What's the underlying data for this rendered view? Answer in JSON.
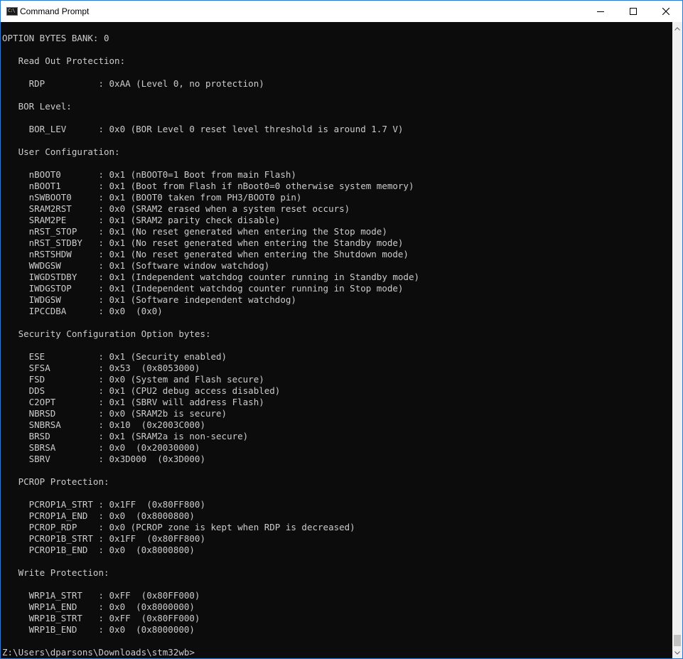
{
  "window": {
    "title": "Command Prompt",
    "icon_name": "cmd-app-icon",
    "icon_glyph": "C:\\",
    "border_color": "#2b79d0",
    "background": "#0c0c0c",
    "foreground": "#cccccc"
  },
  "caption_buttons": {
    "minimize": "minimize-icon",
    "maximize": "maximize-icon",
    "close": "close-icon"
  },
  "console": {
    "lines": [
      "OPTION BYTES BANK: 0",
      "",
      "   Read Out Protection:",
      "",
      "     RDP          : 0xAA (Level 0, no protection)",
      "",
      "   BOR Level:",
      "",
      "     BOR_LEV      : 0x0 (BOR Level 0 reset level threshold is around 1.7 V)",
      "",
      "   User Configuration:",
      "",
      "     nBOOT0       : 0x1 (nBOOT0=1 Boot from main Flash)",
      "     nBOOT1       : 0x1 (Boot from Flash if nBoot0=0 otherwise system memory)",
      "     nSWBOOT0     : 0x1 (BOOT0 taken from PH3/BOOT0 pin)",
      "     SRAM2RST     : 0x0 (SRAM2 erased when a system reset occurs)",
      "     SRAM2PE      : 0x1 (SRAM2 parity check disable)",
      "     nRST_STOP    : 0x1 (No reset generated when entering the Stop mode)",
      "     nRST_STDBY   : 0x1 (No reset generated when entering the Standby mode)",
      "     nRSTSHDW     : 0x1 (No reset generated when entering the Shutdown mode)",
      "     WWDGSW       : 0x1 (Software window watchdog)",
      "     IWGDSTDBY    : 0x1 (Independent watchdog counter running in Standby mode)",
      "     IWDGSTOP     : 0x1 (Independent watchdog counter running in Stop mode)",
      "     IWDGSW       : 0x1 (Software independent watchdog)",
      "     IPCCDBA      : 0x0  (0x0)",
      "",
      "   Security Configuration Option bytes:",
      "",
      "     ESE          : 0x1 (Security enabled)",
      "     SFSA         : 0x53  (0x8053000)",
      "     FSD          : 0x0 (System and Flash secure)",
      "     DDS          : 0x1 (CPU2 debug access disabled)",
      "     C2OPT        : 0x1 (SBRV will address Flash)",
      "     NBRSD        : 0x0 (SRAM2b is secure)",
      "     SNBRSA       : 0x10  (0x2003C000)",
      "     BRSD         : 0x1 (SRAM2a is non-secure)",
      "     SBRSA        : 0x0  (0x20030000)",
      "     SBRV         : 0x3D000  (0x3D000)",
      "",
      "   PCROP Protection:",
      "",
      "     PCROP1A_STRT : 0x1FF  (0x80FF800)",
      "     PCROP1A_END  : 0x0  (0x8000800)",
      "     PCROP_RDP    : 0x0 (PCROP zone is kept when RDP is decreased)",
      "     PCROP1B_STRT : 0x1FF  (0x80FF800)",
      "     PCROP1B_END  : 0x0  (0x8000800)",
      "",
      "   Write Protection:",
      "",
      "     WRP1A_STRT   : 0xFF  (0x80FF000)",
      "     WRP1A_END    : 0x0  (0x8000000)",
      "     WRP1B_STRT   : 0xFF  (0x80FF000)",
      "     WRP1B_END    : 0x0  (0x8000000)",
      "",
      "Z:\\Users\\dparsons\\Downloads\\stm32wb>"
    ]
  },
  "scrollbar": {
    "up_icon": "scroll-up-arrow-icon",
    "down_icon": "scroll-down-arrow-icon"
  }
}
